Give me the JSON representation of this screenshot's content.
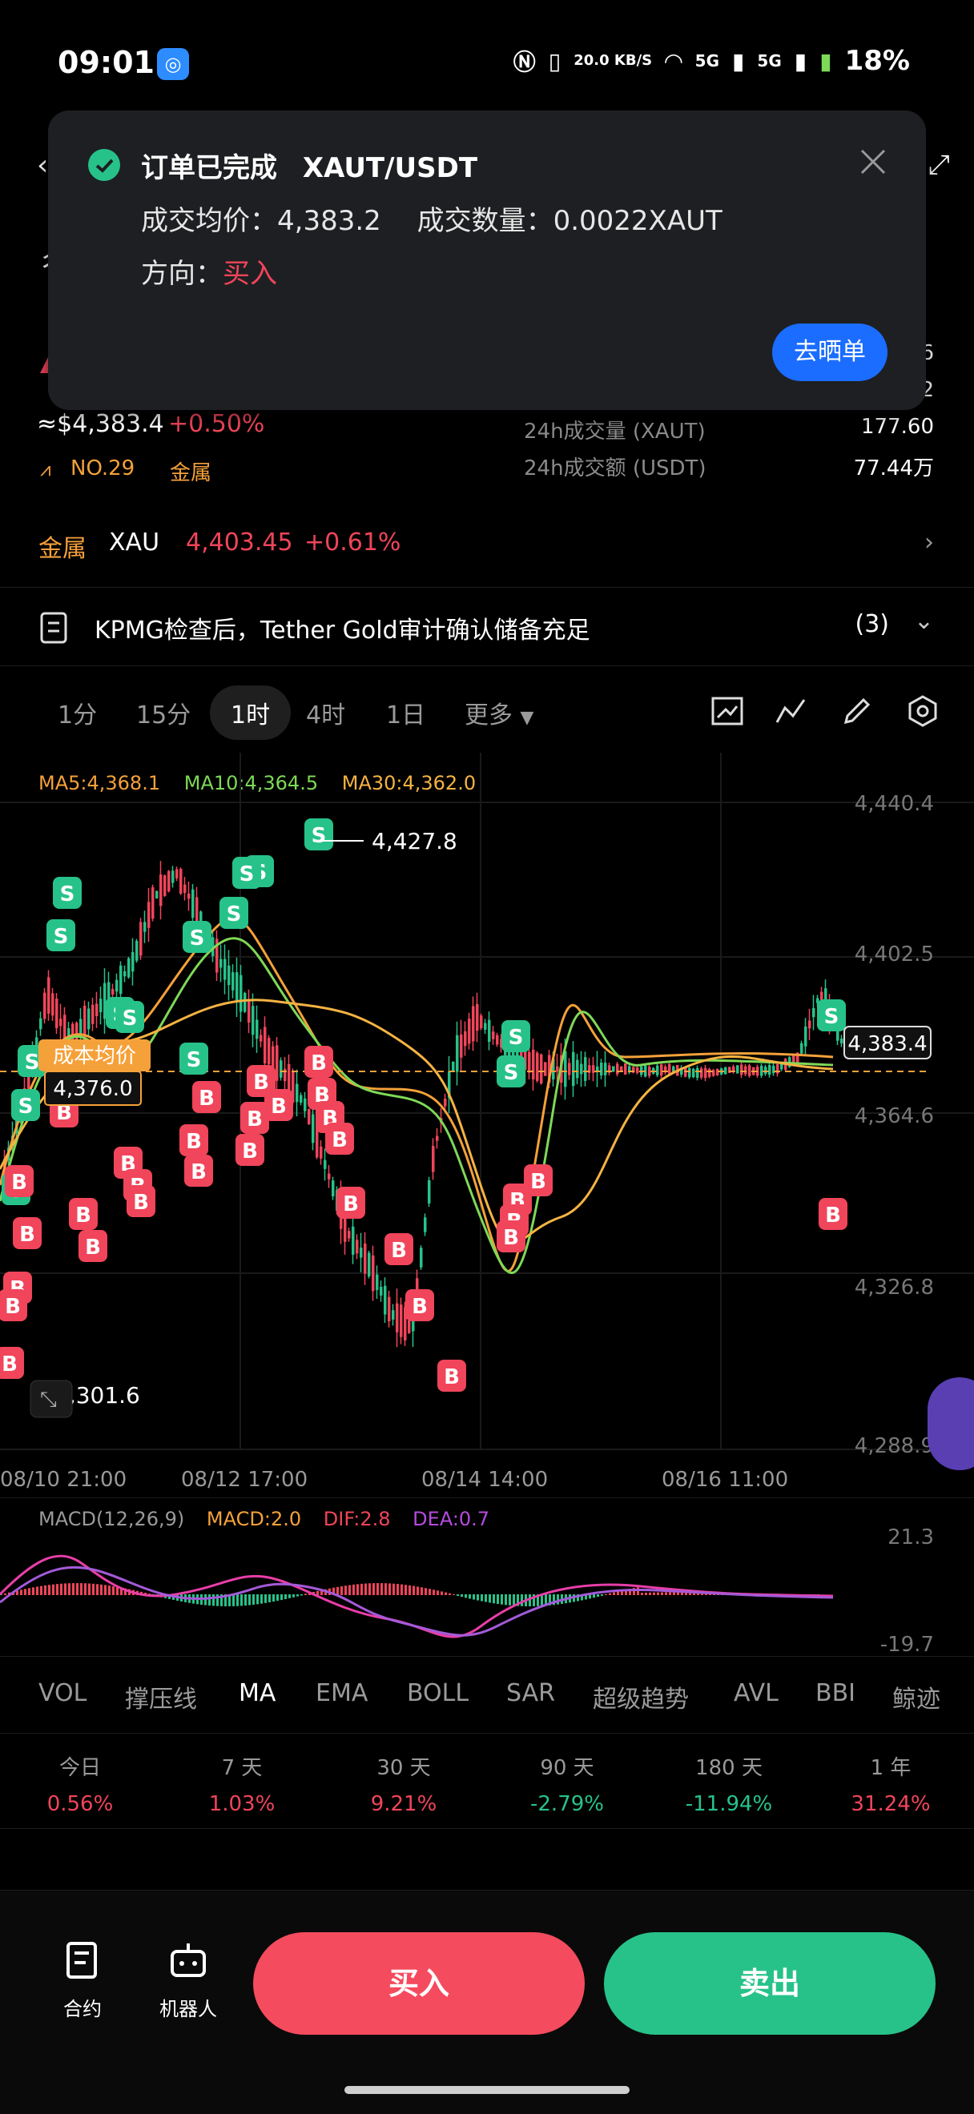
{
  "status_bar": {
    "time": "09:01",
    "net_speed": "20.0 KB/S",
    "battery": "18%",
    "sig1": "5G",
    "sig2": "5G"
  },
  "notification": {
    "title": "订单已完成",
    "pair": "XAUT/USDT",
    "avg_label": "成交均价：",
    "avg_value": "4,383.2",
    "qty_label": "成交数量：",
    "qty_value": "0.0022XAUT",
    "dir_label": "方向：",
    "dir_value": "买入",
    "share_button": "去晒单"
  },
  "ticker": {
    "approx_price": "≈$4,383.4",
    "change_pct": "+0.50%",
    "rank": "NO.29",
    "category": "金属",
    "stats": [
      {
        "label": "24h成交量 (XAUT)",
        "value": "177.60"
      },
      {
        "label": "24h成交额 (USDT)",
        "value": "77.44万"
      }
    ],
    "hidden_vals": [
      "6",
      "2"
    ]
  },
  "metal_row": {
    "label": "金属",
    "symbol": "XAU",
    "price": "4,403.45",
    "pct": "+0.61%"
  },
  "news": {
    "text": "KPMG检查后，Tether Gold审计确认储备充足",
    "count": "(3)"
  },
  "timeframes": [
    "1分",
    "15分",
    "1时",
    "4时",
    "1日",
    "更多"
  ],
  "active_timeframe": "1时",
  "ma_legend": {
    "ma5": "MA5:4,368.1",
    "ma10": "MA10:4,364.5",
    "ma30": "MA30:4,362.0"
  },
  "chart_data": {
    "type": "candlestick",
    "y_ticks": [
      "4,440.4",
      "4,402.5",
      "4,364.6",
      "4,326.8",
      "4,288.9"
    ],
    "x_ticks": [
      "08/10 21:00",
      "08/12 17:00",
      "08/14 14:00",
      "08/16 11:00"
    ],
    "high_marker": "4,427.8",
    "low_marker": "4,301.6",
    "current_price": "4,383.4",
    "cost_label": "成本均价",
    "cost_value": "4,376.0",
    "colors": {
      "up": "#27c28a",
      "down": "#f0455a",
      "ma5": "#f5a13a",
      "ma10": "#7ed957",
      "ma30": "#f5b342"
    }
  },
  "macd": {
    "label": "MACD(12,26,9)",
    "macd": "MACD:2.0",
    "dif": "DIF:2.8",
    "dea": "DEA:0.7",
    "top": "21.3",
    "bottom": "-19.7"
  },
  "indicators": [
    "VOL",
    "撑压线",
    "MA",
    "EMA",
    "BOLL",
    "SAR",
    "超级趋势",
    "AVL",
    "BBI",
    "鲸迹"
  ],
  "active_indicator": "MA",
  "performance": [
    {
      "label": "今日",
      "value": "0.56%",
      "dir": "up"
    },
    {
      "label": "7 天",
      "value": "1.03%",
      "dir": "up"
    },
    {
      "label": "30 天",
      "value": "9.21%",
      "dir": "up"
    },
    {
      "label": "90 天",
      "value": "-2.79%",
      "dir": "down"
    },
    {
      "label": "180 天",
      "value": "-11.94%",
      "dir": "down"
    },
    {
      "label": "1 年",
      "value": "31.24%",
      "dir": "up"
    }
  ],
  "bottom_bar": {
    "contract": "合约",
    "robot": "机器人",
    "buy": "买入",
    "sell": "卖出"
  }
}
